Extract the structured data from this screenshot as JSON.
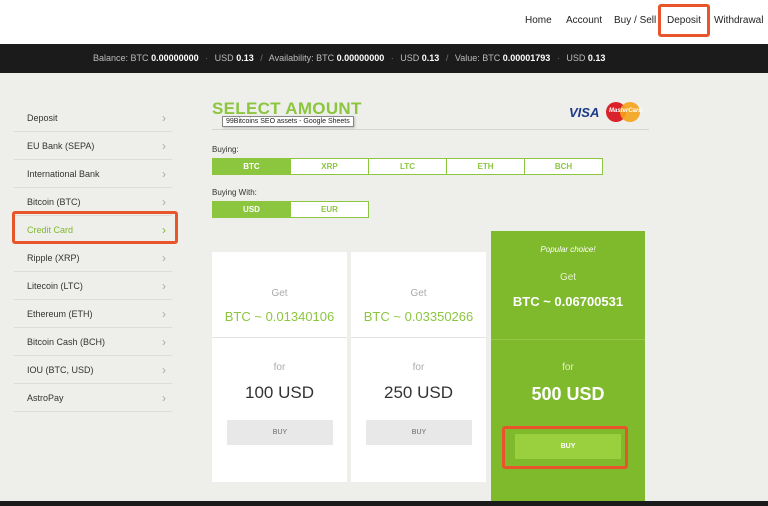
{
  "nav": {
    "items": [
      "Home",
      "Account",
      "Buy / Sell",
      "Deposit",
      "Withdrawal"
    ]
  },
  "balance_bar": {
    "balance_label": "Balance:",
    "balance_btc_prefix": "BTC",
    "balance_btc": "0.00000000",
    "balance_usd_prefix": "USD",
    "balance_usd": "0.13",
    "availability_label": "Availability:",
    "availability_btc_prefix": "BTC",
    "availability_btc": "0.00000000",
    "availability_usd_prefix": "USD",
    "availability_usd": "0.13",
    "value_label": "Value:",
    "value_btc_prefix": "BTC",
    "value_btc": "0.00001793",
    "value_usd_prefix": "USD",
    "value_usd": "0.13"
  },
  "sidebar": {
    "items": [
      {
        "label": "Deposit"
      },
      {
        "label": "EU Bank (SEPA)"
      },
      {
        "label": "International Bank"
      },
      {
        "label": "Bitcoin (BTC)"
      },
      {
        "label": "Credit Card"
      },
      {
        "label": "Ripple (XRP)"
      },
      {
        "label": "Litecoin (LTC)"
      },
      {
        "label": "Ethereum (ETH)"
      },
      {
        "label": "Bitcoin Cash (BCH)"
      },
      {
        "label": "IOU (BTC, USD)"
      },
      {
        "label": "AstroPay"
      }
    ],
    "active": "Credit Card"
  },
  "main": {
    "title": "SELECT AMOUNT",
    "tooltip": "99Bitcoins SEO assets - Google Sheets",
    "visa_text": "VISA",
    "mastercard_text": "MasterCard",
    "buying_label": "Buying:",
    "buying_options": [
      "BTC",
      "XRP",
      "LTC",
      "ETH",
      "BCH"
    ],
    "buying_selected": "BTC",
    "buying_with_label": "Buying With:",
    "buying_with_options": [
      "USD",
      "EUR"
    ],
    "buying_with_selected": "USD"
  },
  "cards": [
    {
      "get_label": "Get",
      "amount": "BTC ~ 0.01340106",
      "for_label": "for",
      "price": "100 USD",
      "buy_label": "BUY"
    },
    {
      "get_label": "Get",
      "amount": "BTC ~ 0.03350266",
      "for_label": "for",
      "price": "250 USD",
      "buy_label": "BUY"
    },
    {
      "popular": "Popular choice!",
      "get_label": "Get",
      "amount": "BTC ~ 0.06700531",
      "for_label": "for",
      "price": "500 USD",
      "buy_label": "BUY"
    }
  ],
  "colors": {
    "accent": "#8cc63f",
    "highlight": "#e8552a",
    "bar": "#1b1b1b"
  }
}
